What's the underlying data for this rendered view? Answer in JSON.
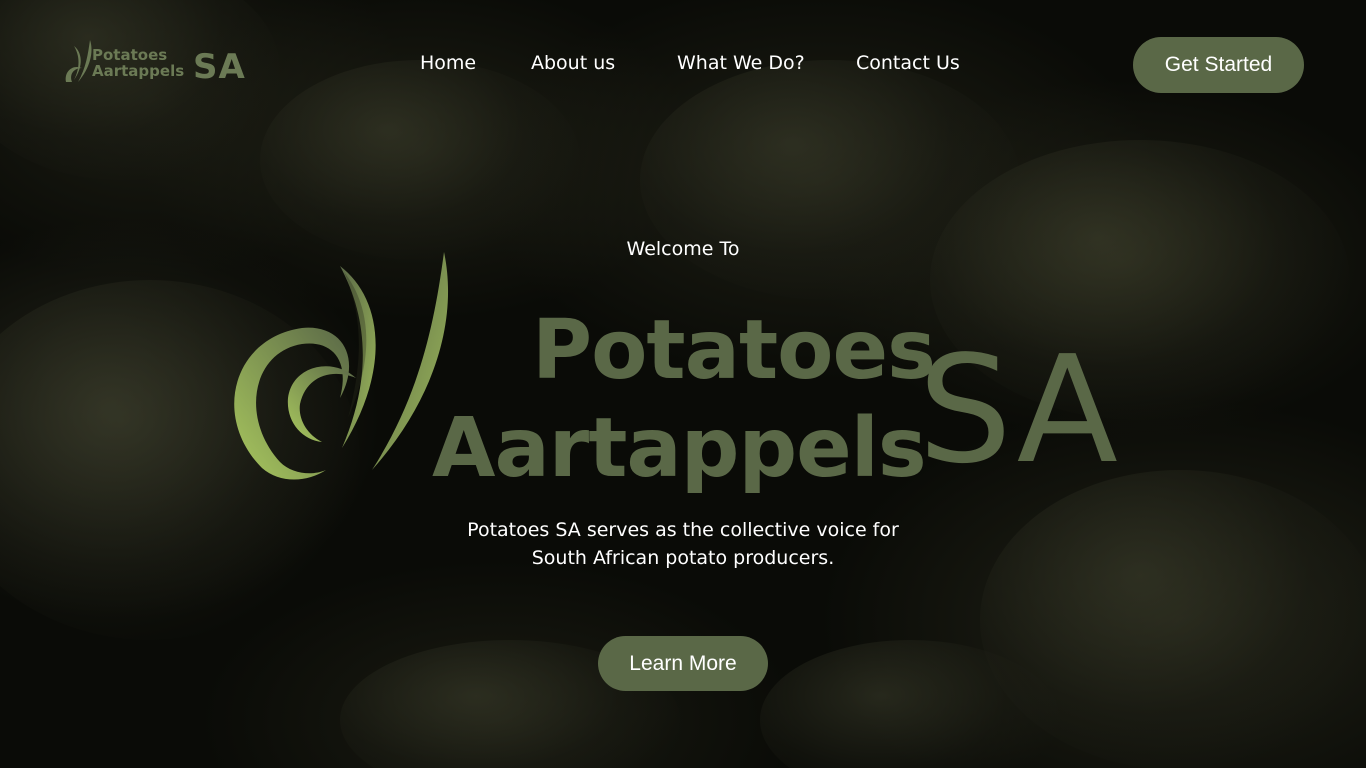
{
  "brand": {
    "line1": "Potatoes",
    "line2": "Aartappels",
    "suffix": "SA",
    "color": "#5a6847"
  },
  "nav": {
    "items": [
      {
        "label": "Home"
      },
      {
        "label": "About us"
      },
      {
        "label": "What We Do?"
      },
      {
        "label": "Contact Us"
      }
    ],
    "cta_label": "Get Started"
  },
  "hero": {
    "welcome": "Welcome To",
    "tagline_line1": "Potatoes SA serves as the collective voice for",
    "tagline_line2": "South African potato producers.",
    "cta_label": "Learn More"
  },
  "icons": {
    "logo_mark": "leaf-swirl-icon"
  },
  "colors": {
    "accent": "#5a6847",
    "logo_green_light": "#9cb85a",
    "background": "#0a0b07",
    "text": "#ffffff"
  }
}
